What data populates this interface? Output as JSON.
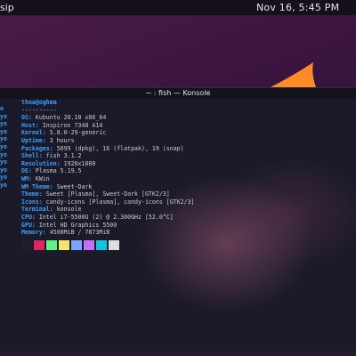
{
  "topbar": {
    "left_text": "sip",
    "clock": "Nov 16, 5:45 PM"
  },
  "konsole": {
    "title": "~ : fish — Konsole",
    "header": "thea@oghma",
    "separator": "----------",
    "info": [
      {
        "key": "OS",
        "value": "Kubuntu 20.10 x86_64"
      },
      {
        "key": "Host",
        "value": "Inspiron 7348 A14"
      },
      {
        "key": "Kernel",
        "value": "5.8.0-29-generic"
      },
      {
        "key": "Uptime",
        "value": "3 hours"
      },
      {
        "key": "Packages",
        "value": "5099 (dpkg), 16 (flatpak), 19 (snap)"
      },
      {
        "key": "Shell",
        "value": "fish 3.1.2"
      },
      {
        "key": "Resolution",
        "value": "1920x1080"
      },
      {
        "key": "DE",
        "value": "Plasma 5.19.5"
      },
      {
        "key": "WM",
        "value": "KWin"
      },
      {
        "key": "WM Theme",
        "value": "Sweet-Dark"
      },
      {
        "key": "Theme",
        "value": "Sweet [Plasma], Sweet-Dark [GTK2/3]"
      },
      {
        "key": "Icons",
        "value": "candy-icons [Plasma], candy-icons [GTK2/3]"
      },
      {
        "key": "Terminal",
        "value": "konsole"
      },
      {
        "key": "CPU",
        "value": "Intel i7-5500U (2) @ 2.300GHz [52.0°C]"
      },
      {
        "key": "GPU",
        "value": "Intel HD Graphics 5500"
      },
      {
        "key": "Memory",
        "value": "4508MiB / 7873MiB"
      }
    ],
    "left_fragments": [
      "o",
      "yo",
      "yo",
      "yo",
      "yo",
      "yo",
      "yo",
      "yo",
      "yo",
      "yo",
      "yo"
    ],
    "swatches": [
      "#1f1f2a",
      "#e0245e",
      "#5ff287",
      "#f4e66c",
      "#7aa6ff",
      "#c46dff",
      "#15c3e0",
      "#dedede"
    ]
  },
  "colors": {
    "accent": "#3aa0ff",
    "wallpaper_orange": "#ff8a2a"
  }
}
